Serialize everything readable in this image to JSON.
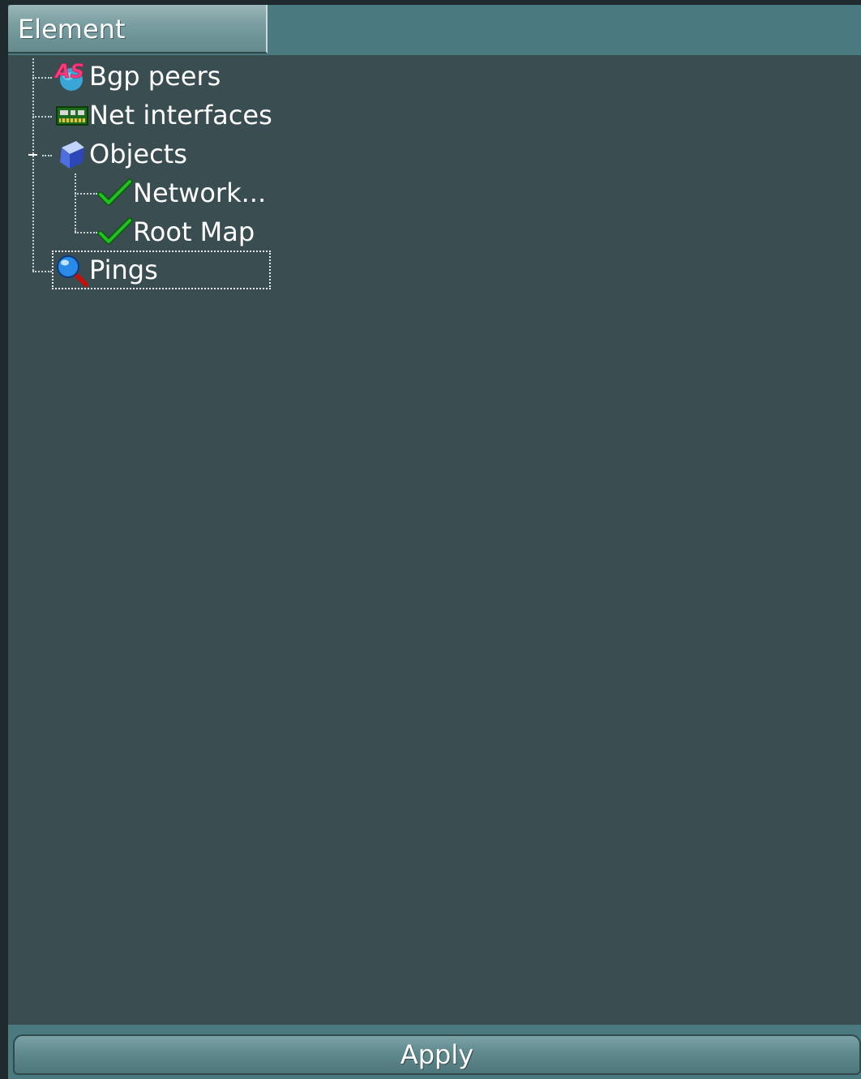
{
  "tree": {
    "column_header": "Element",
    "items": [
      {
        "label": "Bgp peers",
        "icon": "as-globe-icon",
        "icon_text": "AS"
      },
      {
        "label": "Net interfaces",
        "icon": "network-card-icon"
      },
      {
        "label": "Objects",
        "icon": "cube-icon",
        "expanded": true
      },
      {
        "label": "Network...",
        "icon": "checkmark-icon"
      },
      {
        "label": "Root Map",
        "icon": "checkmark-icon"
      },
      {
        "label": "Pings",
        "icon": "magnifier-icon",
        "selected": true
      }
    ]
  },
  "footer": {
    "apply_label": "Apply"
  },
  "colors": {
    "background": "#3a4d51",
    "header": "#4a7a80",
    "check": "#22c022"
  }
}
